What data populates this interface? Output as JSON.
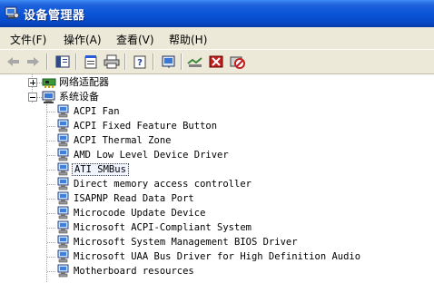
{
  "window": {
    "title": "设备管理器",
    "app_icon": "device-manager-icon"
  },
  "menu": [
    {
      "label": "文件(F)"
    },
    {
      "label": "操作(A)"
    },
    {
      "label": "查看(V)"
    },
    {
      "label": "帮助(H)"
    }
  ],
  "toolbar": {
    "icons": [
      "back-arrow-icon",
      "forward-arrow-icon",
      "console-tree-icon",
      "properties-icon",
      "print-icon",
      "help-icon",
      "scan-hardware-icon",
      "update-driver-icon",
      "uninstall-icon",
      "disable-icon"
    ]
  },
  "tree": {
    "network_adapters": {
      "label": "网络适配器",
      "expanded": false
    },
    "system_devices": {
      "label": "系统设备",
      "expanded": true,
      "items": [
        "ACPI Fan",
        "ACPI Fixed Feature Button",
        "ACPI Thermal Zone",
        "AMD Low Level Device Driver",
        "ATI SMBus",
        "Direct memory access controller",
        "ISAPNP Read Data Port",
        "Microcode Update Device",
        "Microsoft ACPI-Compliant System",
        "Microsoft System Management BIOS Driver",
        "Microsoft UAA Bus Driver for High Definition Audio",
        "Motherboard resources"
      ],
      "selected_item": "ATI SMBus"
    }
  },
  "colors": {
    "titlebar": "#0a55d9",
    "chrome": "#ece9d8",
    "selection_border": "#444444"
  }
}
